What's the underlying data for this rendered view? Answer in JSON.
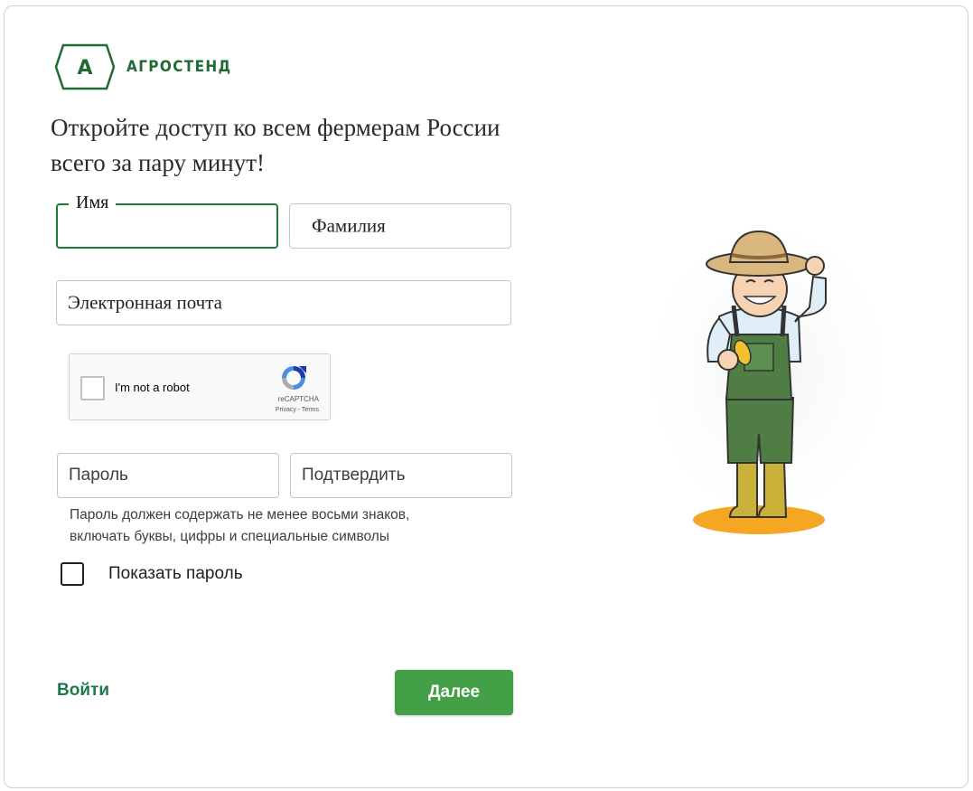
{
  "brand": {
    "logo_letter": "А",
    "name": "АГРОСТЕНД",
    "color": "#1f6b35"
  },
  "headline": {
    "line1": "Откройте доступ ко всем фермерам России",
    "line2": "всего за пару минут!"
  },
  "form": {
    "first_name_label": "Имя",
    "first_name_value": "",
    "last_name_placeholder": "Фамилия",
    "email_placeholder": "Электронная почта",
    "password_placeholder": "Пароль",
    "confirm_placeholder": "Подтвердить",
    "password_hint_line1": "Пароль должен содержать не менее восьми знаков,",
    "password_hint_line2": "включать буквы, цифры и специальные символы",
    "show_password_label": "Показать пароль",
    "show_password_checked": false
  },
  "recaptcha": {
    "label": "I'm not a robot",
    "brand": "reCAPTCHA",
    "links": "Privacy - Terms",
    "checked": false
  },
  "actions": {
    "login_label": "Войти",
    "next_label": "Далее"
  },
  "colors": {
    "accent": "#1e7a3c",
    "button": "#43a047",
    "link": "#1d7a4b"
  },
  "illustration": {
    "icon": "farmer-illustration"
  }
}
